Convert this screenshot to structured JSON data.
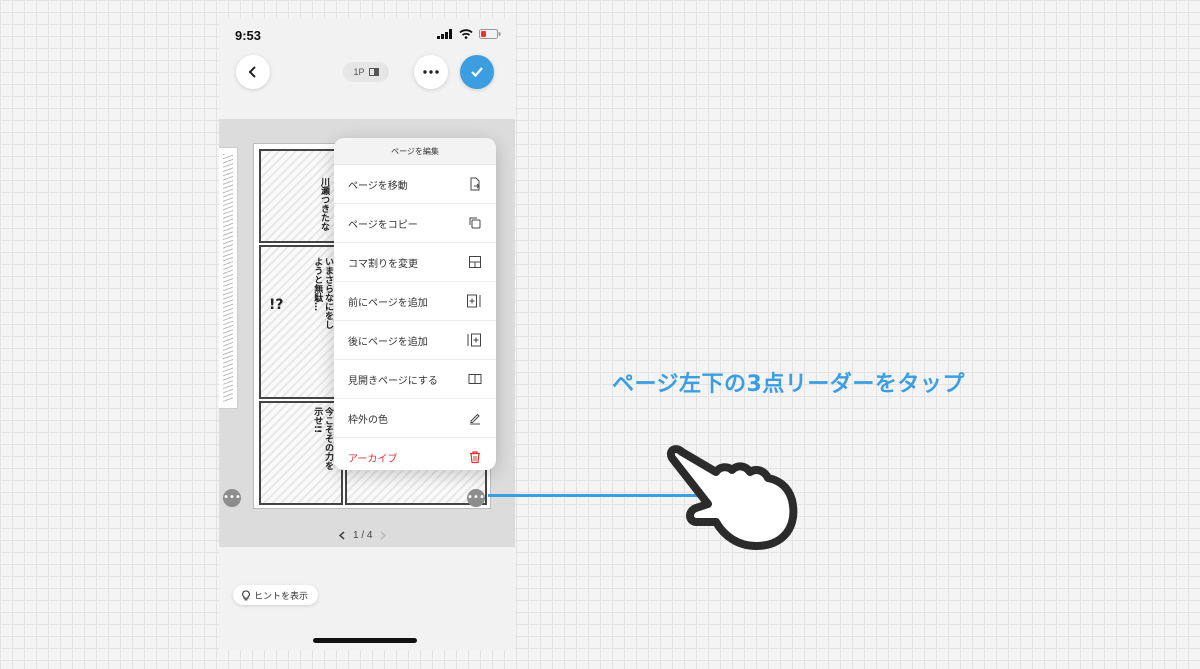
{
  "status_bar": {
    "time": "9:53"
  },
  "top_bar": {
    "page_mode_label": "1P",
    "back_icon": "chevron-left-icon",
    "more_icon": "ellipsis-icon",
    "done_icon": "check-icon",
    "accent_color": "#3a9ee0"
  },
  "manga": {
    "panel_texts": [
      "川瀬つきたな",
      "いまさらなにをしようと無駄…",
      "!?",
      "今こそその力を示せ!!"
    ]
  },
  "menu": {
    "title": "ページを編集",
    "items": [
      {
        "label": "ページを移動",
        "icon": "file-move-icon"
      },
      {
        "label": "ページをコピー",
        "icon": "copy-icon"
      },
      {
        "label": "コマ割りを変更",
        "icon": "layout-grid-icon"
      },
      {
        "label": "前にページを追加",
        "icon": "add-page-before-icon"
      },
      {
        "label": "後にページを追加",
        "icon": "add-page-after-icon"
      },
      {
        "label": "見開きページにする",
        "icon": "spread-icon"
      },
      {
        "label": "枠外の色",
        "icon": "pen-icon"
      },
      {
        "label": "アーカイブ",
        "icon": "trash-icon"
      }
    ]
  },
  "pager": {
    "text": "1 / 4"
  },
  "hint": {
    "label": "ヒントを表示",
    "icon": "lightbulb-icon"
  },
  "instruction": {
    "text": "ページ左下の3点リーダーをタップ"
  }
}
